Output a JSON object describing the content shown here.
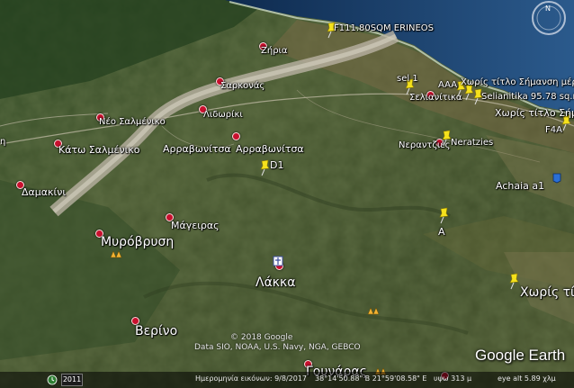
{
  "places": {
    "zeria": "Ζήρια",
    "sarkonas": "Σαρκονάς",
    "neo_salmeniko": "Νέο Σαλμένικο",
    "lidoriki": "Λιδωρίκι",
    "kato_salmeniko": "Κάτω Σαλμένικο",
    "arravonitsa1": "Αρραβωνίτσα",
    "arravonitsa2": "Αρραβωνίτσα",
    "damakini": "Δαμακίνι",
    "mageiras": "Μάγειρας",
    "myrovrysi": "Μυρόβρυση",
    "lakka": "Λάκκα",
    "verino": "Βερίνο",
    "gounaras": "Γουνάρας",
    "selianitika": "Σελιανίτικα",
    "nerantzies_gr": "Νεραντζιές",
    "n_partial": "η"
  },
  "placemarks": {
    "erineos": "F111.80SQM ERINEOS",
    "sel1": "sel 1",
    "aaa": "AAA",
    "choris_top": "Χωρίς τίτλο Σήμανση μέρους",
    "selianitika_sqm": "Selianitika 95.78 sq.m",
    "choris_mid": "Χωρίς τίτλο Σήμανση",
    "f4a": "F4A",
    "neratzies": "Neratzies",
    "d1": "D1",
    "achaia": "Achaia a1",
    "a": "A",
    "choris_bottom": "Χωρίς τίτ"
  },
  "attribution": {
    "copyright": "© 2018 Google",
    "data": "Data SIO, NOAA, U.S. Navy, NGA, GEBCO",
    "logo": "Google Earth"
  },
  "status": {
    "year": "2011",
    "imagery_date": "Ημερομηνία εικόνων: 9/8/2017",
    "coords": "38°14'50.88\" B   21°59'08.58\" E",
    "elev": "υψω   313 μ",
    "eye_alt": "eye alt   5.89 χλμ"
  },
  "colors": {
    "sea": "#1d3f6e",
    "land": "#46562f",
    "placemark_yellow": "#f5e11c",
    "place_dot": "#c8102e",
    "placemark_blue": "#2a6fd6"
  },
  "icons": {
    "placemark": "yellow-pushpin-icon",
    "place": "red-dot-icon",
    "compass": "compass-icon",
    "camp": "campsite-icon",
    "monastery": "church-icon"
  }
}
